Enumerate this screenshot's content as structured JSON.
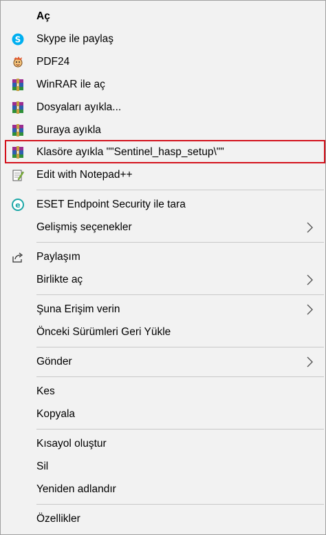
{
  "menu": {
    "items": [
      {
        "label": "Aç"
      },
      {
        "label": "Skype ile paylaş",
        "icon": "skype-icon"
      },
      {
        "label": "PDF24",
        "icon": "pdf24-icon"
      },
      {
        "label": "WinRAR ile aç",
        "icon": "winrar-icon"
      },
      {
        "label": "Dosyaları ayıkla...",
        "icon": "winrar-icon"
      },
      {
        "label": "Buraya ayıkla",
        "icon": "winrar-icon"
      },
      {
        "label": "Klasöre ayıkla \"\"Sentinel_hasp_setup\\\"\"",
        "icon": "winrar-icon"
      },
      {
        "label": "Edit with Notepad++",
        "icon": "notepad-plus-icon"
      },
      {
        "label": "ESET Endpoint Security ile tara",
        "icon": "eset-icon"
      },
      {
        "label": "Gelişmiş seçenekler",
        "icon": "chevron-right-icon"
      },
      {
        "label": "Paylaşım",
        "icon": "share-icon"
      },
      {
        "label": "Birlikte aç",
        "icon": "chevron-right-icon"
      },
      {
        "label": "Şuna Erişim verin",
        "icon": "chevron-right-icon"
      },
      {
        "label": "Önceki Sürümleri Geri Yükle"
      },
      {
        "label": "Gönder",
        "icon": "chevron-right-icon"
      },
      {
        "label": "Kes"
      },
      {
        "label": "Kopyala"
      },
      {
        "label": "Kısayol oluştur"
      },
      {
        "label": "Sil"
      },
      {
        "label": "Yeniden adlandır"
      },
      {
        "label": "Özellikler"
      }
    ],
    "highlight_color": "#d3101b"
  }
}
